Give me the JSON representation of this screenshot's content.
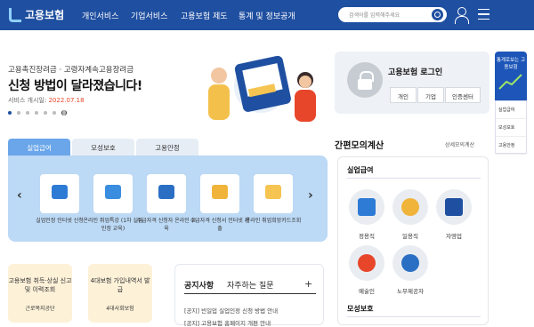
{
  "header": {
    "logo": "고용보험",
    "nav": [
      "개인서비스",
      "기업서비스",
      "고용보험 제도",
      "통계 및 정보공개"
    ],
    "search_placeholder": "검색어를 입력해주세요"
  },
  "hero": {
    "subtitle": "고용촉진장려금 · 고령자계속고용장려금",
    "title": "신청 방법이 달라졌습니다!",
    "date_label": "서비스 개시일:",
    "date_value": "2022.07.18"
  },
  "login": {
    "title": "고용보험 로그인",
    "buttons": [
      "개인",
      "기업",
      "인증센터"
    ]
  },
  "side": {
    "banner": "통계로보는 고용보험",
    "links": [
      "실업급여",
      "모성보호",
      "고용안정"
    ]
  },
  "tabs": [
    "실업급여",
    "모성보호",
    "고용안정"
  ],
  "services": [
    {
      "label": "실업인정 인터넷 신청",
      "color": "#2e7bd6"
    },
    {
      "label": "온라인 취업특강 (1차 실업인정 교육)",
      "color": "#3a8ddf"
    },
    {
      "label": "수급자격 신청자 온라인 교육",
      "color": "#2b6fc4"
    },
    {
      "label": "수급자격 신청서 인터넷 제출",
      "color": "#f0b43a"
    },
    {
      "label": "온라인 취업희망카드조회",
      "color": "#f5c451"
    }
  ],
  "cards": [
    {
      "text": "고용보험 취득·상실 신고 및 이력조회",
      "foot": "근로복지공단",
      "bg": "#fdf1d8"
    },
    {
      "text": "4대보험 가입내역서 발급",
      "foot": "4대사회보험",
      "bg": "#fdf1d8"
    }
  ],
  "notice": {
    "tabs": [
      "공지사항",
      "자주하는 질문"
    ],
    "rows": [
      "[공지] 빈일업 실업인정 신청 방법 안내",
      "[공지] 고용보험 홈페이지 개편 안내"
    ]
  },
  "calc": {
    "title": "간편모의계산",
    "more": "상세모의계산",
    "section": "실업급여",
    "items": [
      "정용직",
      "일용직",
      "자영업",
      "예술인",
      "노무제공자"
    ],
    "section2": "모성보호"
  },
  "colors": {
    "primary": "#1f4fa0",
    "accent": "#e8462a",
    "panel": "#bcd9f5"
  }
}
